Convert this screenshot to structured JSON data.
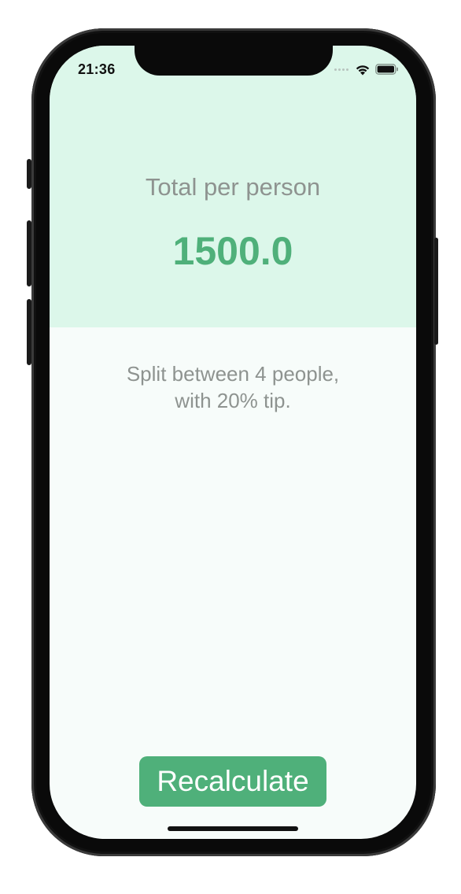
{
  "status_bar": {
    "time": "21:36",
    "icons": [
      "signal-dots-icon",
      "wifi-icon",
      "battery-icon"
    ]
  },
  "result": {
    "title": "Total per person",
    "amount": "1500.0"
  },
  "summary": {
    "line1": "Split between 4 people,",
    "line2": "with 20% tip."
  },
  "actions": {
    "recalculate_label": "Recalculate"
  },
  "colors": {
    "accent": "#4fb07a",
    "top_panel": "#dcf7ea",
    "background": "#f7fcfa",
    "secondary_text": "#8e9390"
  }
}
